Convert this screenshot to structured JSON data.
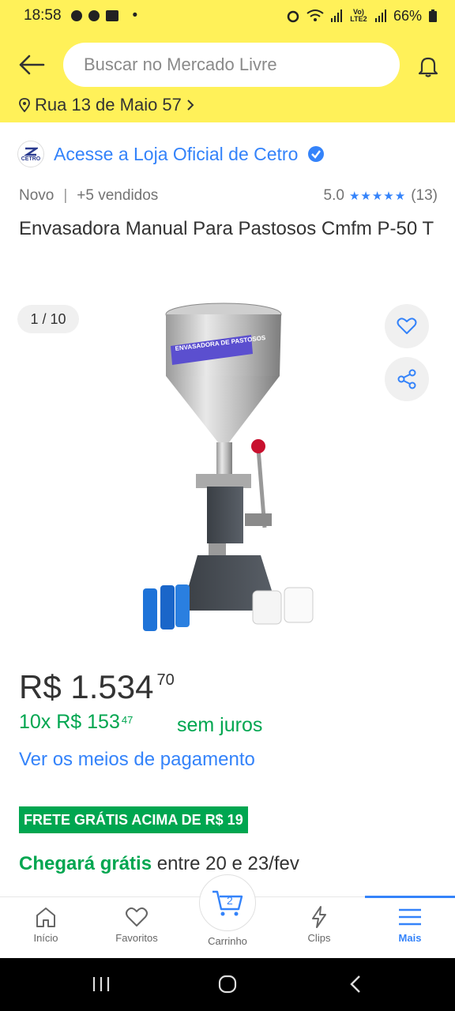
{
  "status_bar": {
    "time": "18:58",
    "dot": "•",
    "battery": "66%",
    "network": "Vo) LTE2"
  },
  "header": {
    "search_placeholder": "Buscar no Mercado Livre",
    "location": "Rua 13 de Maio 57",
    "back_icon": "arrow-left-icon",
    "notification_icon": "bell-icon"
  },
  "store": {
    "logo_text": "CETRO",
    "link_text": "Acesse a Loja Oficial de Cetro"
  },
  "product": {
    "condition": "Novo",
    "sold": "+5 vendidos",
    "rating": "5.0",
    "stars": "★★★★★",
    "review_count": "(13)",
    "title": "Envasadora Manual Para Pastosos Cmfm P-50 T",
    "gallery_counter": "1 / 10",
    "hopper_label": "ENVASADORA DE PASTOSOS"
  },
  "pricing": {
    "price_main": "R$ 1.534",
    "price_cents": "70",
    "installment_main": "10x R$ 153",
    "installment_cents": "47",
    "interest": "sem juros",
    "payment_link": "Ver os meios de pagamento"
  },
  "shipping": {
    "badge": "FRETE GRÁTIS ACIMA DE R$ 19",
    "arrival_bold": "Chegará grátis",
    "arrival_rest": "entre 20 e 23/fev"
  },
  "bottom_nav": {
    "items": [
      {
        "label": "Início",
        "icon": "home-icon"
      },
      {
        "label": "Favoritos",
        "icon": "heart-icon"
      },
      {
        "label": "Carrinho",
        "icon": "cart-icon",
        "badge": "2"
      },
      {
        "label": "Clips",
        "icon": "bolt-icon"
      },
      {
        "label": "Mais",
        "icon": "menu-icon",
        "active": true
      }
    ]
  },
  "colors": {
    "header_yellow": "#fff159",
    "link_blue": "#3483fa",
    "green": "#00a650"
  }
}
